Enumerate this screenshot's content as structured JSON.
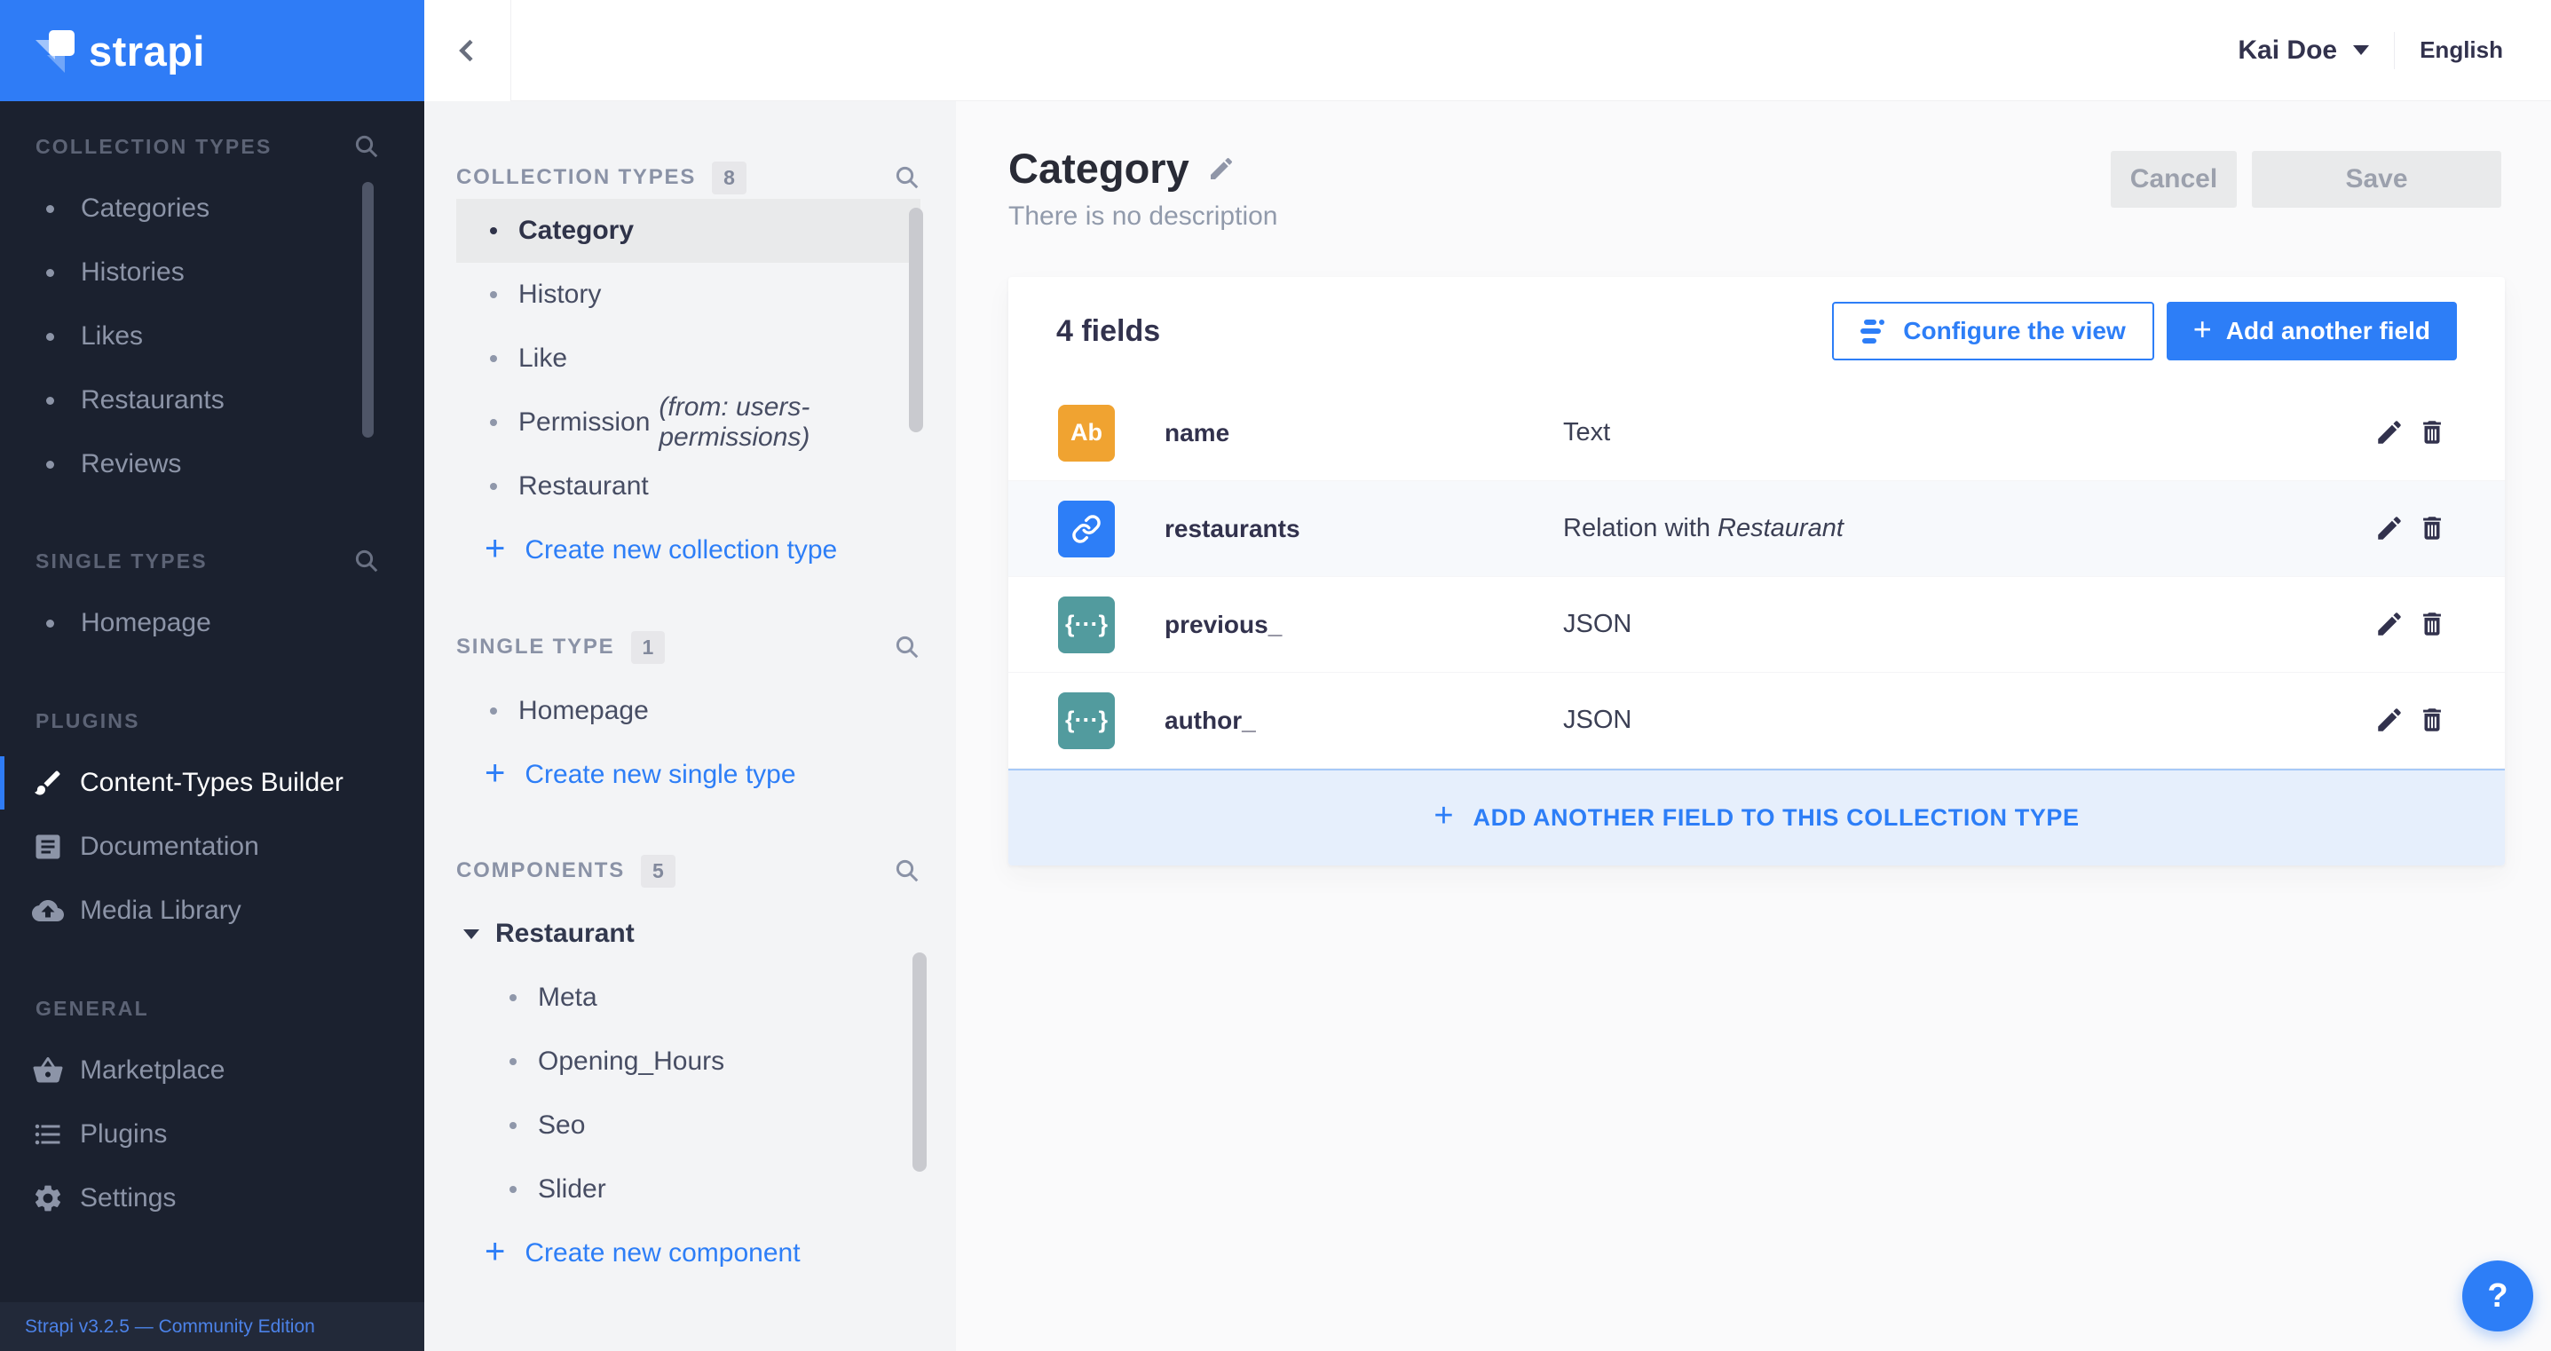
{
  "colors": {
    "accent_blue": "#2D7EF7",
    "logo_blue": "#2F7CF6",
    "sidebar_bg": "#1B212F",
    "panel_bg": "#F3F4F6",
    "main_bg": "#FAFAFB",
    "badge_text_orange": "#F0A331",
    "badge_relation_blue": "#2D7EF7",
    "badge_json_teal": "#529B9E",
    "add_bar_bg": "#E6EFFC"
  },
  "branding": {
    "logo_text": "strapi",
    "footer_link": "Strapi v3.2.5 — Community Edition"
  },
  "topbar": {
    "user_name": "Kai Doe",
    "language": "English"
  },
  "sidebar": {
    "collection_types": {
      "header": "COLLECTION TYPES",
      "items": [
        "Categories",
        "Histories",
        "Likes",
        "Restaurants",
        "Reviews"
      ]
    },
    "single_types": {
      "header": "SINGLE TYPES",
      "items": [
        "Homepage"
      ]
    },
    "plugins": {
      "header": "PLUGINS",
      "items": [
        "Content-Types Builder",
        "Documentation",
        "Media Library"
      ]
    },
    "general": {
      "header": "GENERAL",
      "items": [
        "Marketplace",
        "Plugins",
        "Settings"
      ]
    }
  },
  "panel": {
    "collection_types": {
      "header": "COLLECTION TYPES",
      "count": "8",
      "active_item": "Category",
      "items": [
        "History",
        "Like"
      ],
      "permission_item": {
        "label": "Permission",
        "suffix": "(from: users-permissions)"
      },
      "last_item": "Restaurant",
      "create_label": "Create new collection type"
    },
    "single_type": {
      "header": "SINGLE TYPE",
      "count": "1",
      "items": [
        "Homepage"
      ],
      "create_label": "Create new single type"
    },
    "components": {
      "header": "COMPONENTS",
      "count": "5",
      "group": "Restaurant",
      "children": [
        "Meta",
        "Opening_Hours",
        "Seo",
        "Slider"
      ],
      "create_label": "Create new component"
    }
  },
  "main": {
    "title": "Category",
    "subtitle": "There is no description",
    "cancel_label": "Cancel",
    "save_label": "Save",
    "card": {
      "fields_count": "4 fields",
      "configure_label": "Configure the view",
      "add_field_label": "Add another field",
      "rows": [
        {
          "badge": "Ab",
          "name": "name",
          "type": "Text"
        },
        {
          "badge": "",
          "name": "restaurants",
          "type_prefix": "Relation with",
          "type_italic": "Restaurant"
        },
        {
          "badge": "{···}",
          "name": "previous_",
          "type": "JSON"
        },
        {
          "badge": "{···}",
          "name": "author_",
          "type": "JSON"
        }
      ],
      "add_bar_label": "ADD ANOTHER FIELD TO THIS COLLECTION TYPE"
    }
  },
  "icons": {
    "plus": "+",
    "question_mark": "?"
  }
}
